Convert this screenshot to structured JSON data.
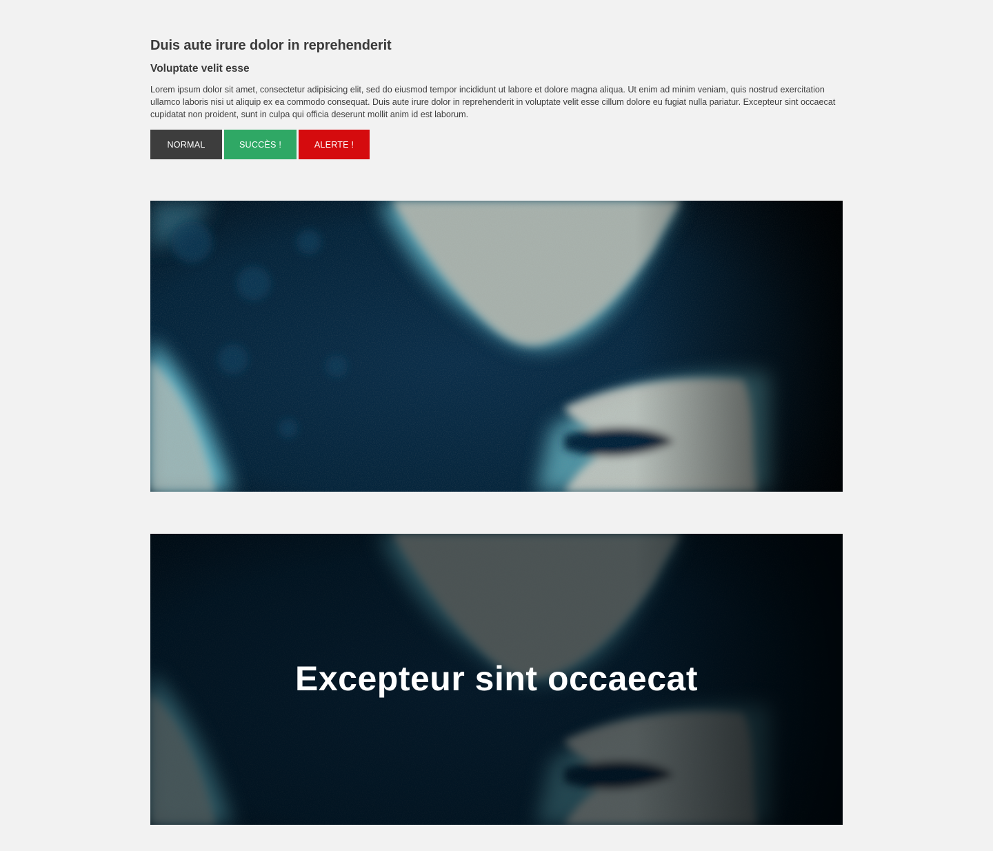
{
  "content": {
    "title": "Duis aute irure dolor in reprehenderit",
    "subtitle": "Voluptate velit esse",
    "paragraph": "Lorem ipsum dolor sit amet, consectetur adipisicing elit, sed do eiusmod tempor incididunt ut labore et dolore magna aliqua. Ut enim ad minim veniam, quis nostrud exercitation ullamco laboris nisi ut aliquip ex ea commodo consequat. Duis aute irure dolor in reprehenderit in voluptate velit esse cillum dolore eu fugiat nulla pariatur. Excepteur sint occaecat cupidatat non proident, sunt in culpa qui officia deserunt mollit anim id est laborum."
  },
  "buttons": {
    "normal": "NORMAL",
    "success": "SUCCÈS !",
    "alert": "ALERTE !"
  },
  "hero": {
    "text": "Excepteur sint occaecat"
  },
  "colors": {
    "background": "#f2f2f2",
    "text": "#3d3d3d",
    "normal": "#3d3d3d",
    "success": "#2fa865",
    "alert": "#d50b0e"
  }
}
